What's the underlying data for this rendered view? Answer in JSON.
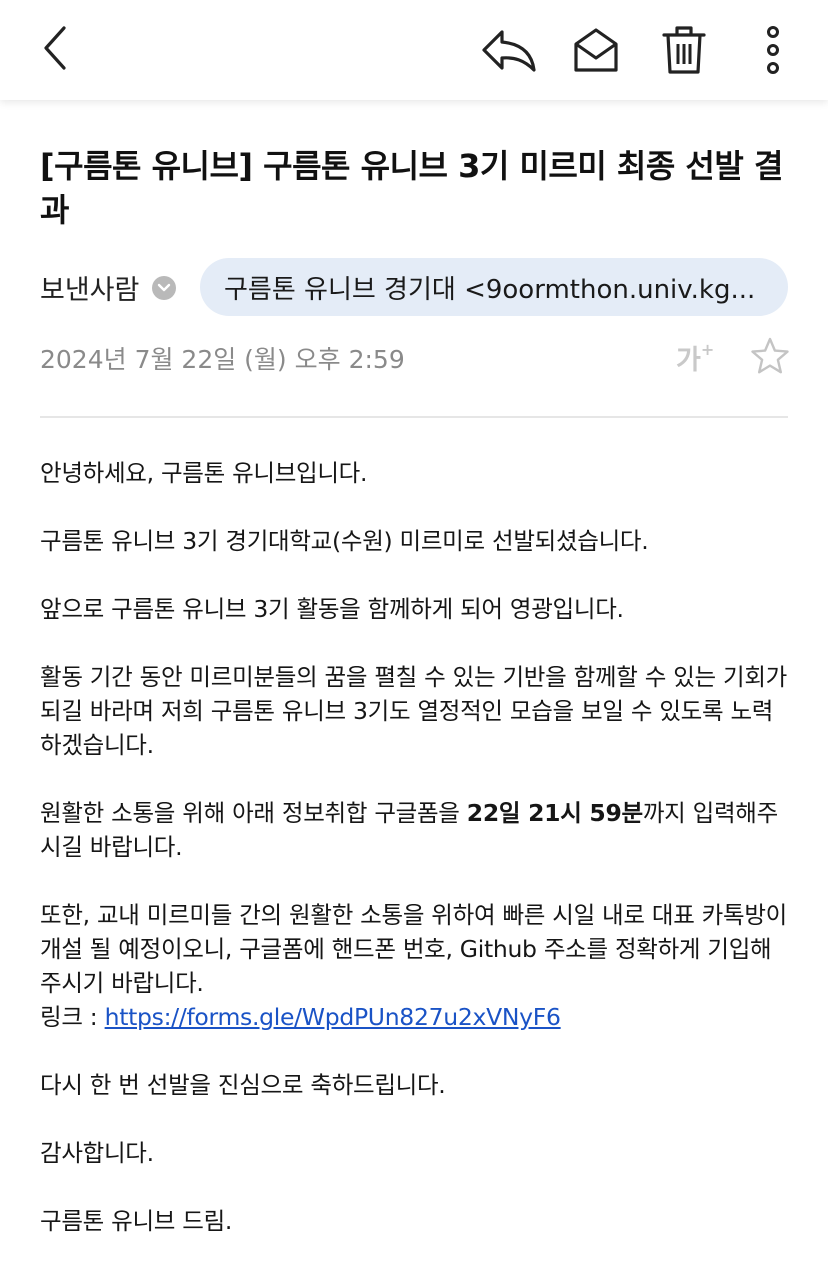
{
  "toolbar": {
    "back_icon": "chevron-left-icon",
    "reply_icon": "reply-icon",
    "mail_icon": "open-envelope-icon",
    "delete_icon": "trash-icon",
    "more_icon": "more-vertical-icon"
  },
  "email": {
    "subject": "[구름톤 유니브] 구름톤 유니브 3기 미르미 최종 선발 결과",
    "sender_label": "보낸사람",
    "sender": "구름톤 유니브 경기대 <9oormthon.univ.kg...",
    "date": "2024년 7월 22일 (월) 오후 2:59",
    "font_size_label": "가",
    "font_size_plus": "+",
    "body": {
      "greeting": "안녕하세요, 구름톤 유니브입니다.",
      "selection": "구름톤 유니브 3기 경기대학교(수원) 미르미로 선발되셨습니다.",
      "honor": "앞으로 구름톤 유니브 3기 활동을 함께하게 되어 영광입니다.",
      "wish": "활동 기간 동안 미르미분들의 꿈을 펼칠 수 있는 기반을 함께할 수 있는 기회가 되길 바라며 저희 구름톤 유니브 3기도 열정적인 모습을 보일 수 있도록 노력하겠습니다.",
      "form_pre": "원활한 소통을 위해 아래 정보취합 구글폼을 ",
      "form_deadline": "22일 21시 59분",
      "form_post": "까지 입력해주시길 바랍니다.",
      "kakao": "또한, 교내 미르미들 간의 원활한 소통을 위하여 빠른 시일 내로 대표 카톡방이 개설 될 예정이오니, 구글폼에 핸드폰 번호, Github 주소를 정확하게 기입해주시기 바랍니다.",
      "link_label": "링크 : ",
      "link_url": "https://forms.gle/WpdPUn827u2xVNyF6",
      "congrats": "다시 한 번 선발을 진심으로 축하드립니다.",
      "thanks": "감사합니다.",
      "signature": "구름톤 유니브 드림."
    }
  }
}
